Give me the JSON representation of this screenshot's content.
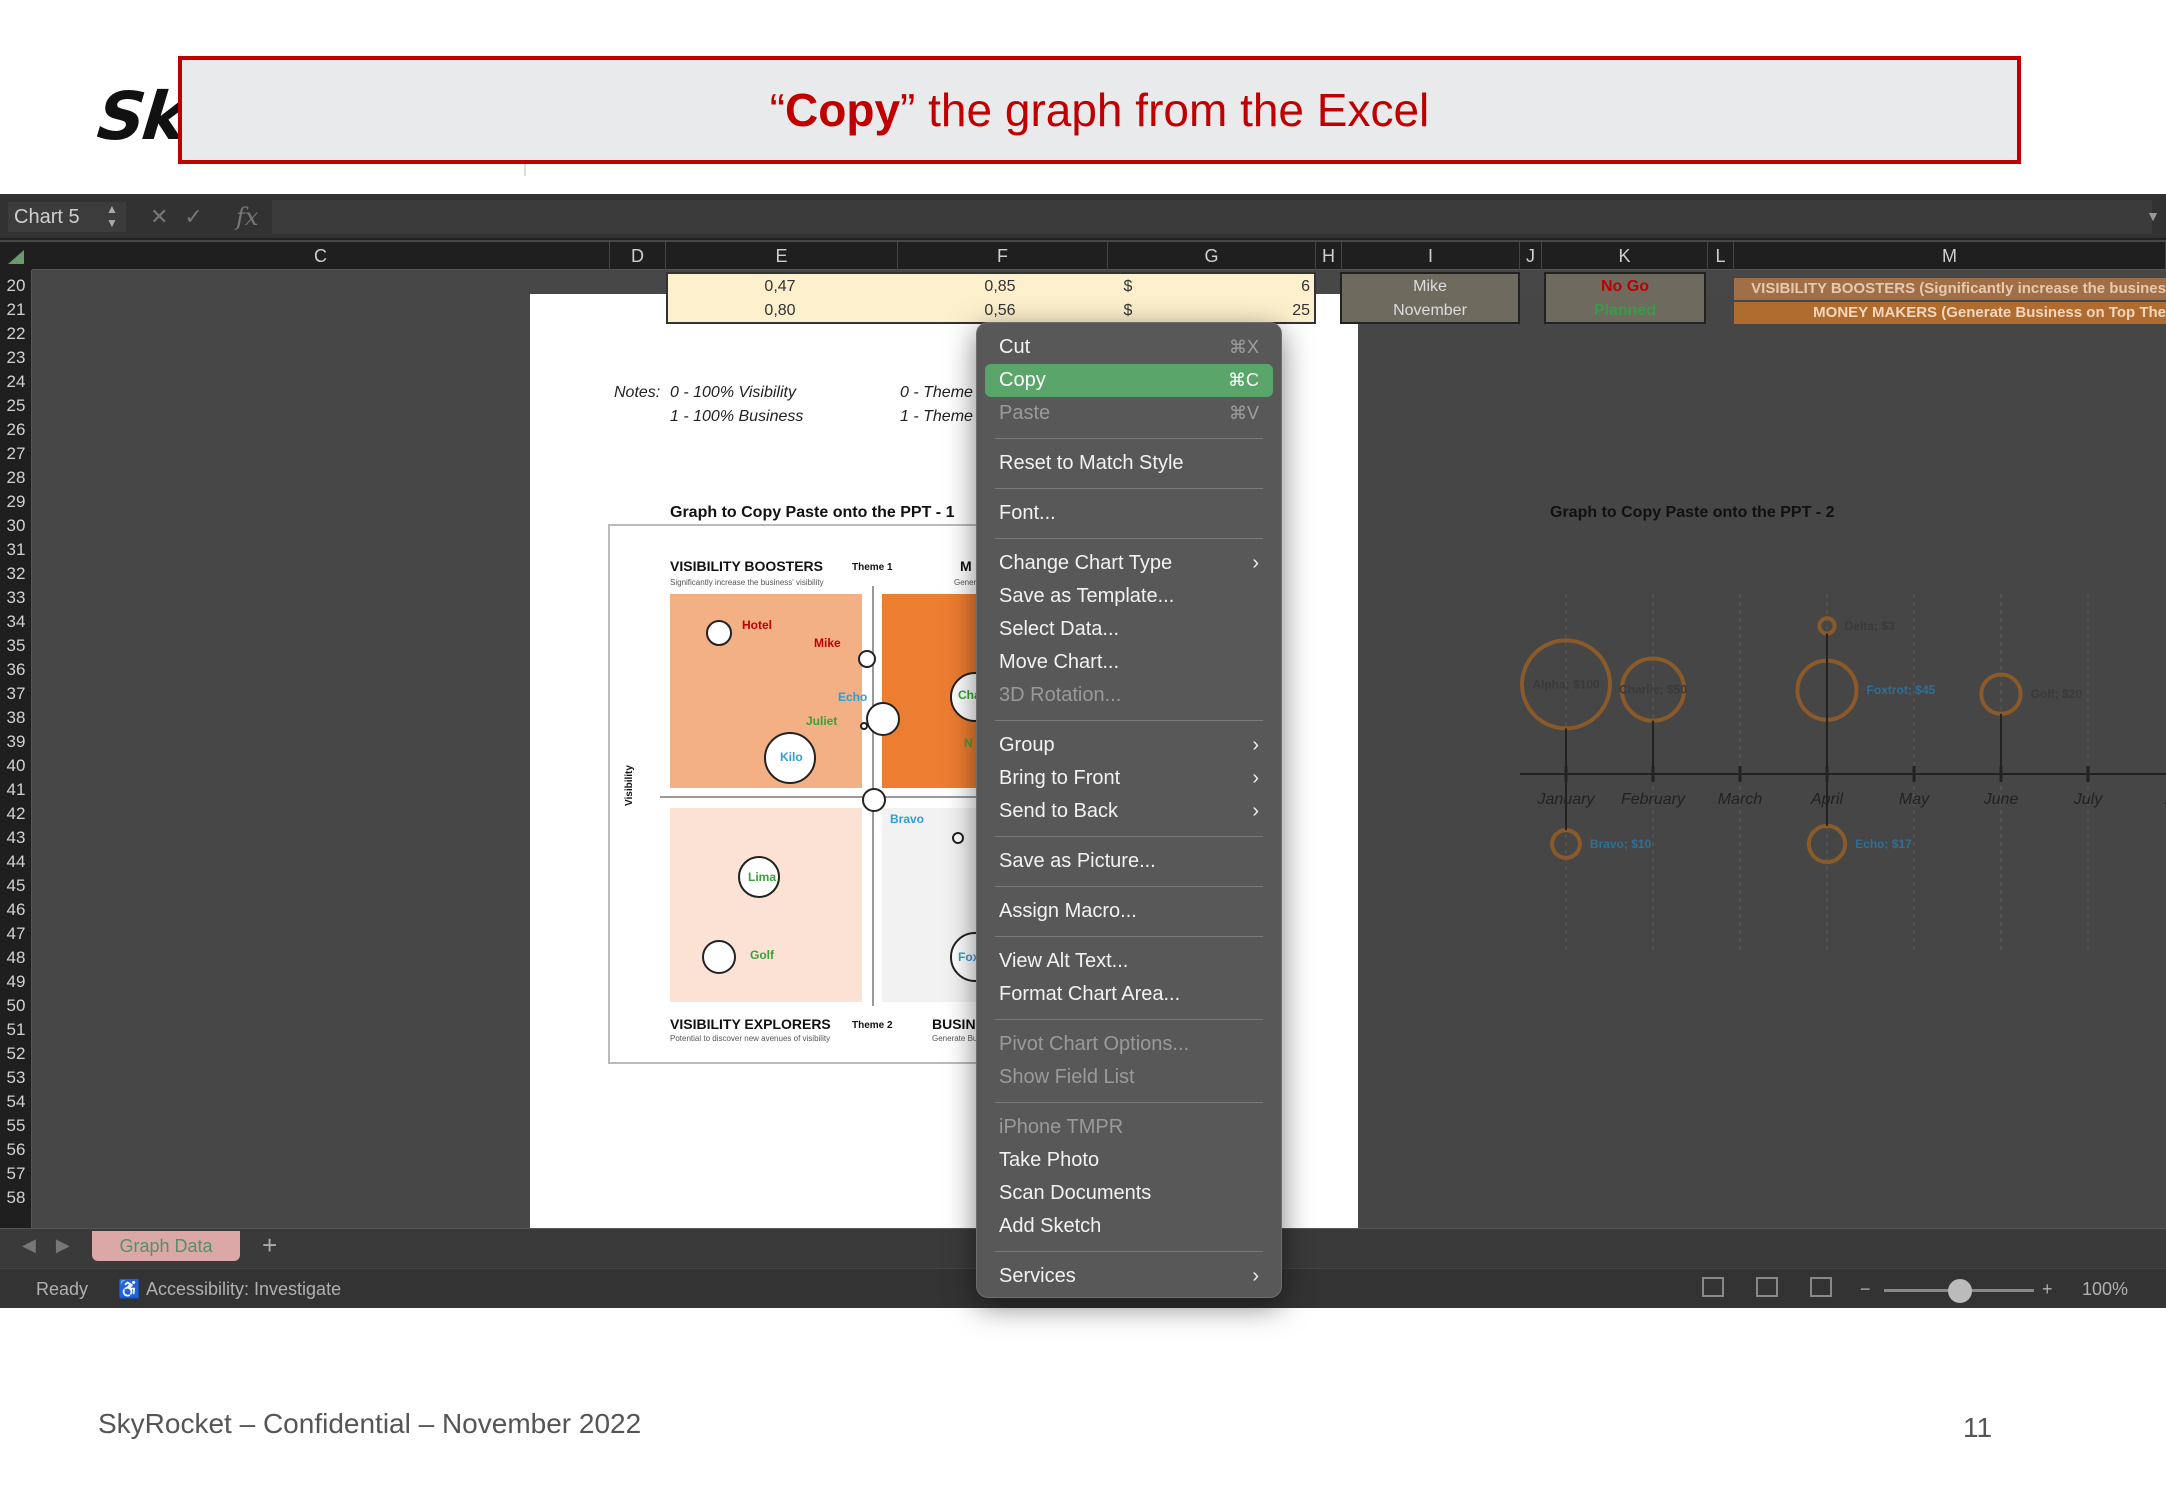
{
  "slide": {
    "logo_text": "Sky",
    "callout_quote_open": "“",
    "callout_bold": "Copy",
    "callout_rest": "” the graph from the Excel",
    "footer": "SkyRocket – Confidential – November 2022",
    "page_number": "11"
  },
  "excel": {
    "name_box": "Chart 5",
    "columns": [
      "C",
      "D",
      "E",
      "F",
      "G",
      "H",
      "I",
      "J",
      "K",
      "L",
      "M"
    ],
    "rows": [
      "20",
      "21",
      "22",
      "23",
      "24",
      "25",
      "26",
      "27",
      "28",
      "29",
      "30",
      "31",
      "32",
      "33",
      "34",
      "35",
      "36",
      "37",
      "38",
      "39",
      "40",
      "41",
      "42",
      "43",
      "44",
      "45",
      "46",
      "47",
      "48",
      "49",
      "50",
      "51",
      "52",
      "53",
      "54",
      "55",
      "56",
      "57",
      "58"
    ],
    "table": {
      "row20": {
        "e": "0,47",
        "f": "0,85",
        "g_currency": "$",
        "g_value": "6",
        "i": "Mike",
        "k": "No Go",
        "m": "VISIBILITY BOOSTERS (Significantly increase the busines"
      },
      "row21": {
        "e": "0,80",
        "f": "0,56",
        "g_currency": "$",
        "g_value": "25",
        "i": "November",
        "k": "Planned",
        "m": "MONEY MAKERS (Generate Business on Top The"
      }
    },
    "notes": {
      "label": "Notes:",
      "line1": "0 - 100% Visibility",
      "line2": "1 - 100% Business",
      "theme1": "0 - Theme",
      "theme2": "1 - Theme"
    },
    "graph1_title": "Graph to Copy Paste onto the PPT - 1",
    "graph2_title": "Graph to Copy Paste onto the PPT - 2",
    "sheet_tab": "Graph Data",
    "status_ready": "Ready",
    "status_accessibility": "Accessibility: Investigate",
    "zoom": "100%"
  },
  "chart_data": [
    {
      "type": "scatter",
      "title": "Graph to Copy Paste onto the PPT - 1",
      "ylabel": "Visibility",
      "quadrants": [
        {
          "name": "VISIBILITY BOOSTERS",
          "subtitle": "Significantly increase the business' visibility",
          "theme": "Theme 1",
          "color": "#f2b084"
        },
        {
          "name": "M",
          "subtitle": "Gener",
          "color": "#ed7d31"
        },
        {
          "name": "VISIBILITY EXPLORERS",
          "subtitle": "Potential to discover new avenues of visibility",
          "theme": "Theme 2",
          "color": "#fbe2d5"
        },
        {
          "name": "BUSIN",
          "subtitle": "Generate Bu",
          "color": "#f2f2f2"
        }
      ],
      "points": [
        {
          "label": "Hotel",
          "color": "#c00000"
        },
        {
          "label": "Mike",
          "color": "#c00000"
        },
        {
          "label": "Echo",
          "color": "#2e9fd6"
        },
        {
          "label": "Juliet",
          "color": "#3aa13a"
        },
        {
          "label": "Kilo",
          "color": "#2e9fd6"
        },
        {
          "label": "Bravo",
          "color": "#2e9fd6"
        },
        {
          "label": "Lima",
          "color": "#3aa13a"
        },
        {
          "label": "Golf",
          "color": "#3aa13a"
        },
        {
          "label": "Cha",
          "color": "#3aa13a"
        },
        {
          "label": "N",
          "color": "#3aa13a"
        },
        {
          "label": "Fox",
          "color": "#2e9fd6"
        }
      ]
    },
    {
      "type": "scatter",
      "title": "Graph to Copy Paste onto the PPT - 2",
      "categories": [
        "January",
        "February",
        "March",
        "April",
        "May",
        "June",
        "July",
        "Au"
      ],
      "points": [
        {
          "label": "Alpha; $100",
          "month": "January",
          "value": 100,
          "side": "above"
        },
        {
          "label": "Charlie; $50",
          "month": "February",
          "value": 50,
          "side": "above"
        },
        {
          "label": "Foxtrot; $45",
          "month": "April",
          "value": 45,
          "side": "above"
        },
        {
          "label": "Delta; $3",
          "month": "April",
          "value": 3,
          "side": "above"
        },
        {
          "label": "Golf; $20",
          "month": "June",
          "value": 20,
          "side": "above"
        },
        {
          "label": "Bravo; $10",
          "month": "January",
          "value": 10,
          "side": "below"
        },
        {
          "label": "Echo; $17",
          "month": "April",
          "value": 17,
          "side": "below"
        }
      ]
    }
  ],
  "context_menu": {
    "items": [
      {
        "label": "Cut",
        "shortcut": "⌘X",
        "state": "normal"
      },
      {
        "label": "Copy",
        "shortcut": "⌘C",
        "state": "highlighted"
      },
      {
        "label": "Paste",
        "shortcut": "⌘V",
        "state": "disabled"
      },
      {
        "label": "Reset to Match Style",
        "state": "normal"
      },
      {
        "label": "Font...",
        "state": "normal"
      },
      {
        "label": "Change Chart Type",
        "state": "normal",
        "submenu": true
      },
      {
        "label": "Save as Template...",
        "state": "normal"
      },
      {
        "label": "Select Data...",
        "state": "normal"
      },
      {
        "label": "Move Chart...",
        "state": "normal"
      },
      {
        "label": "3D Rotation...",
        "state": "disabled"
      },
      {
        "label": "Group",
        "state": "normal",
        "submenu": true
      },
      {
        "label": "Bring to Front",
        "state": "normal",
        "submenu": true
      },
      {
        "label": "Send to Back",
        "state": "normal",
        "submenu": true
      },
      {
        "label": "Save as Picture...",
        "state": "normal"
      },
      {
        "label": "Assign Macro...",
        "state": "normal"
      },
      {
        "label": "View Alt Text...",
        "state": "normal"
      },
      {
        "label": "Format Chart Area...",
        "state": "normal"
      },
      {
        "label": "Pivot Chart Options...",
        "state": "disabled"
      },
      {
        "label": "Show Field List",
        "state": "disabled"
      },
      {
        "label": "iPhone TMPR",
        "state": "disabled"
      },
      {
        "label": "Take Photo",
        "state": "normal"
      },
      {
        "label": "Scan Documents",
        "state": "normal"
      },
      {
        "label": "Add Sketch",
        "state": "normal"
      },
      {
        "label": "Services",
        "state": "normal",
        "submenu": true
      }
    ]
  },
  "colors": {
    "accent_red": "#c00000",
    "menu_highlight": "#59a56a",
    "excel_bg": "#474747"
  }
}
